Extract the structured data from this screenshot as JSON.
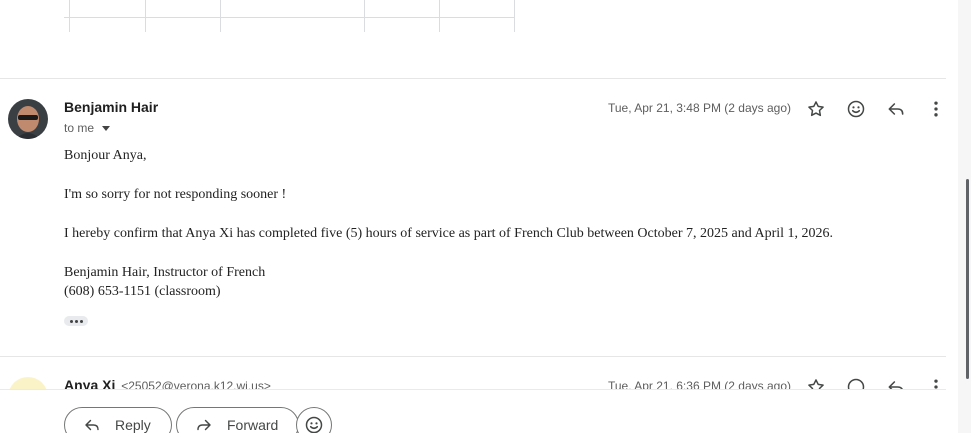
{
  "message": {
    "sender_name": "Benjamin Hair",
    "to_label": "to me",
    "date": "Tue, Apr 21, 3:48 PM (2 days ago)",
    "body": [
      "Bonjour Anya,",
      "I'm so sorry for not responding sooner !",
      "I hereby confirm that Anya Xi has completed five (5) hours of service as part of French Club between October 7, 2025 and April 1, 2026.",
      "Benjamin Hair, Instructor of French",
      "(608) 653-1151 (classroom)"
    ]
  },
  "next_message": {
    "sender_name": "Anya Xi",
    "sender_email": "<25052@verona.k12.wi.us>",
    "date": "Tue, Apr 21, 6:36 PM (2 days ago)"
  },
  "actions": {
    "star_icon": "star-outline-icon",
    "emoji_icon": "emoji-react-icon",
    "reply_icon": "reply-arrow-icon",
    "more_icon": "more-vertical-icon"
  },
  "reply_bar": {
    "reply_label": "Reply",
    "forward_label": "Forward"
  },
  "colors": {
    "border": "#747775",
    "text_muted": "#5e5e5e"
  }
}
